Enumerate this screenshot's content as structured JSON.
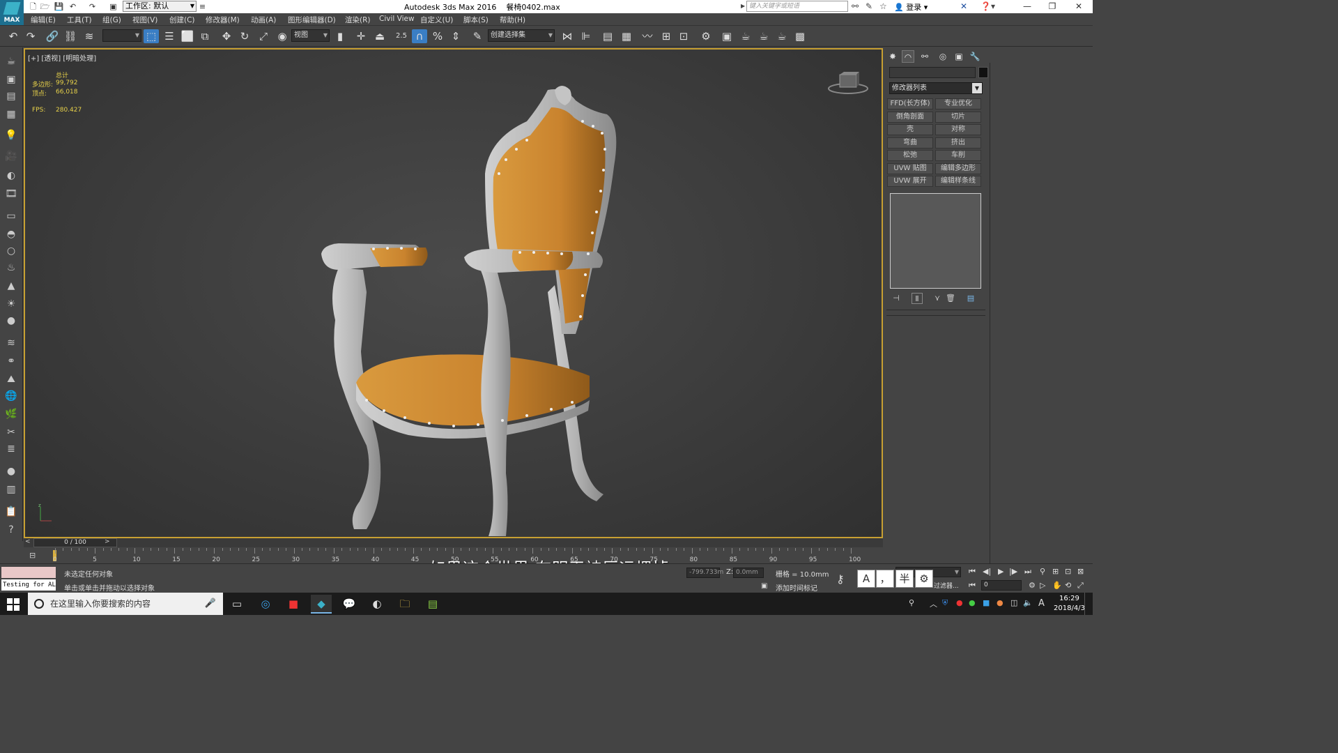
{
  "app": {
    "title": "Autodesk 3ds Max 2016",
    "file": "餐椅0402.max",
    "logo_text": "MAX",
    "workspace_label": "工作区: 默认",
    "search_placeholder": "键入关键字或短语",
    "login_label": "登录"
  },
  "menu": [
    "编辑(E)",
    "工具(T)",
    "组(G)",
    "视图(V)",
    "创建(C)",
    "修改器(M)",
    "动画(A)",
    "图形编辑器(D)",
    "渲染(R)",
    "Civil View",
    "自定义(U)",
    "脚本(S)",
    "帮助(H)"
  ],
  "toolbar": {
    "view_dropdown": "视图",
    "snap_value": "2.5",
    "selection_set_placeholder": "创建选择集"
  },
  "viewport": {
    "label": "[+] [透视] [明暗处理]",
    "stats_total_label": "总计",
    "polys_label": "多边形:",
    "polys_value": "99,792",
    "verts_label": "顶点:",
    "verts_value": "66,018",
    "fps_label": "FPS:",
    "fps_value": "280.427",
    "border_color": "#c8a032",
    "chair_leather_color": "#c9832e",
    "chair_frame_color": "#b4b4b4"
  },
  "command_panel": {
    "modifier_list_label": "修改器列表",
    "modifier_buttons": [
      [
        "FFD(长方体)",
        "专业优化"
      ],
      [
        "倒角剖面",
        "切片"
      ],
      [
        "壳",
        "对称"
      ],
      [
        "弯曲",
        "挤出"
      ],
      [
        "松弛",
        "车削"
      ],
      [
        "UVW 贴图",
        "编辑多边形"
      ],
      [
        "UVW 展开",
        "编辑样条线"
      ]
    ]
  },
  "timeline": {
    "frame_display": "0 / 100",
    "ticks": [
      "0",
      "5",
      "10",
      "15",
      "20",
      "25",
      "30",
      "35",
      "40",
      "45",
      "50",
      "55",
      "60",
      "65",
      "70",
      "75",
      "80",
      "85",
      "90",
      "95",
      "100"
    ]
  },
  "status": {
    "maxscript_text": "Testing for AL",
    "selection_status": "未选定任何对象",
    "prompt": "单击或单击并拖动以选择对象",
    "x_value": "-799.733m",
    "z_label": "Z:",
    "z_value": "0.0mm",
    "grid_label": "栅格 = 10.0mm",
    "add_time_tag": "添加时间标记",
    "filter_label": "过滤器...",
    "frame_value": "0"
  },
  "subtitle": "如果这个世界 在明天被厄运埋掉",
  "ime": [
    "A",
    "，",
    "半",
    "⚙"
  ],
  "taskbar": {
    "search_text": "在这里输入你要搜索的内容",
    "time": "16:29",
    "date": "2018/4/3",
    "lang": "A"
  }
}
